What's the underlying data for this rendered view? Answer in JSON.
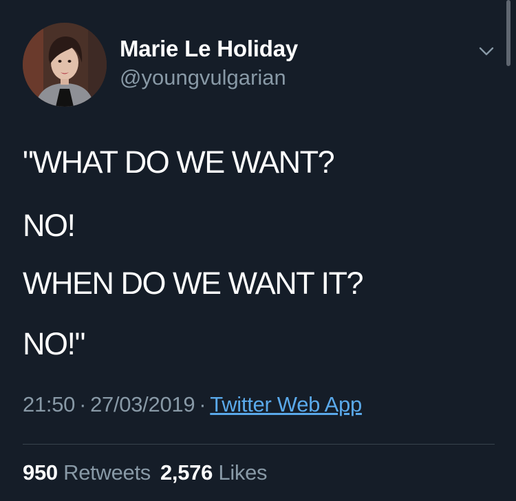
{
  "author": {
    "display_name": "Marie Le Holiday",
    "handle": "@youngvulgarian"
  },
  "tweet": {
    "lines": [
      "\"WHAT DO WE WANT?",
      "NO!",
      "WHEN DO WE WANT IT?",
      "NO!\""
    ],
    "time": "21:50",
    "date": "27/03/2019",
    "separator": "·",
    "source": "Twitter Web App"
  },
  "stats": {
    "retweets_count": "950",
    "retweets_label": "Retweets",
    "likes_count": "2,576",
    "likes_label": "Likes"
  },
  "icons": {
    "menu": "chevron-down-icon"
  },
  "colors": {
    "background": "#151d28",
    "secondary_text": "#8899a6",
    "link": "#5aa9ea",
    "divider": "#38444d"
  }
}
